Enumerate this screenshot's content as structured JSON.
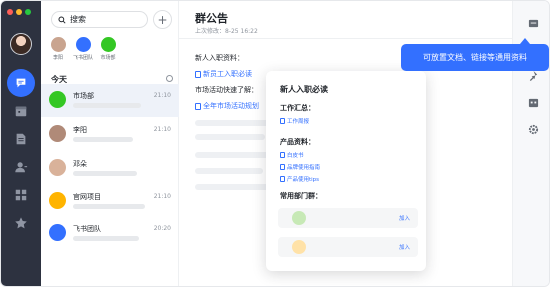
{
  "colors": {
    "accent": "#3370ff",
    "rail_bg": "#2d3240",
    "selected_row": "#eef2f9"
  },
  "search": {
    "placeholder": "搜索"
  },
  "quick_contacts": [
    {
      "label": "李阳",
      "color": "#c9a48f"
    },
    {
      "label": "飞书团队",
      "color": "#3370ff"
    },
    {
      "label": "市场部",
      "color": "#34c724"
    }
  ],
  "chat_list": {
    "section_label": "今天",
    "items": [
      {
        "name": "市场部",
        "time": "21:10",
        "avatar_color": "#34c724",
        "selected": true
      },
      {
        "name": "李阳",
        "time": "21:10",
        "avatar_color": "#b08a78",
        "selected": false
      },
      {
        "name": "邓朵",
        "time": "",
        "avatar_color": "#d9b29a",
        "selected": false
      },
      {
        "name": "官网项目",
        "time": "21:10",
        "avatar_color": "#ffb400",
        "selected": false
      },
      {
        "name": "飞书团队",
        "time": "20:20",
        "avatar_color": "#3370ff",
        "selected": false
      }
    ]
  },
  "announcement": {
    "title": "群公告",
    "subtitle": "上次修改：8-25 16:22",
    "section1": "新人入职资料：",
    "link1": "新员工入职必读",
    "section2": "市场活动快速了解：",
    "link2": "全年市场活动规划"
  },
  "card": {
    "title": "新人入职必读",
    "work_summary": "工作汇总：",
    "work_links": [
      "工作周报"
    ],
    "product_heading": "产品资料：",
    "product_links": [
      "白皮书",
      "品牌使用指南",
      "产品使用tips"
    ],
    "groups_heading": "常用部门群：",
    "join_label": "加入"
  },
  "tooltip": {
    "text": "可放置文档、链接等通用资料"
  },
  "icons": {
    "rail": [
      "chat-bubble-icon",
      "calendar-icon",
      "docs-icon",
      "contacts-icon",
      "workplace-grid-icon",
      "star-icon"
    ],
    "right_bar": [
      "announcement-icon",
      "pin-icon",
      "calendar-icon",
      "settings-gear-icon"
    ]
  }
}
